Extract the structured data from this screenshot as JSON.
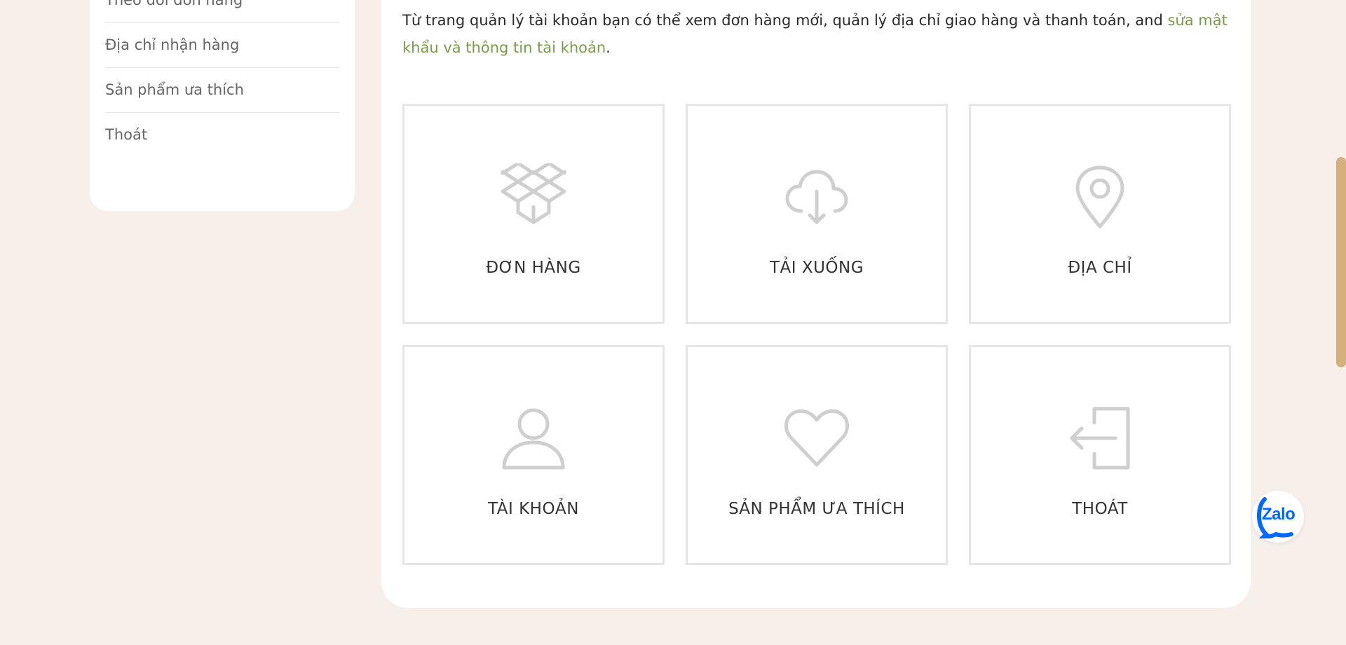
{
  "sidebar": {
    "items": [
      {
        "label": "Theo dõi đơn hàng"
      },
      {
        "label": "Địa chỉ nhận hàng"
      },
      {
        "label": "Sản phẩm ưa thích"
      },
      {
        "label": "Thoát"
      }
    ]
  },
  "main": {
    "intro_text": "Từ trang quản lý tài khoản bạn có thể xem đơn hàng mới, quản lý địa chỉ giao hàng và thanh toán, and ",
    "intro_link": "sửa mật khẩu và thông tin tài khoản",
    "intro_end": ".",
    "tiles": [
      {
        "label": "ĐƠN HÀNG",
        "icon": "box-icon"
      },
      {
        "label": "TẢI XUỐNG",
        "icon": "cloud-download-icon"
      },
      {
        "label": "ĐỊA CHỈ",
        "icon": "map-pin-icon"
      },
      {
        "label": "TÀI KHOẢN",
        "icon": "user-icon"
      },
      {
        "label": "SẢN PHẨM ƯA THÍCH",
        "icon": "heart-icon"
      },
      {
        "label": "THOÁT",
        "icon": "logout-icon"
      }
    ]
  },
  "zalo": {
    "label": "Zalo"
  },
  "colors": {
    "background": "#f7f0ea",
    "link": "#7a9b4b",
    "icon": "#cfcfcf",
    "scrollbar": "#d4b07e",
    "zalo": "#0068ff"
  }
}
